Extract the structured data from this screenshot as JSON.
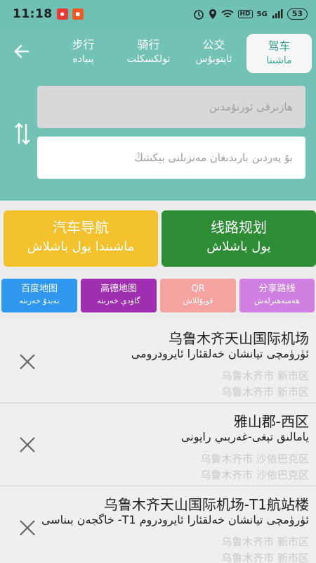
{
  "status": {
    "time": "11:18",
    "network": "5G",
    "hd": "HD",
    "battery": "53"
  },
  "header": {
    "tabs": [
      {
        "zh": "步行",
        "ug": "پىيادە"
      },
      {
        "zh": "骑行",
        "ug": "تولكسكلت"
      },
      {
        "zh": "公交",
        "ug": "ئاپتوبۇس"
      },
      {
        "zh": "驾车",
        "ug": "ماشىنا"
      }
    ],
    "from_placeholder": "ھازىرقى ئورنۇمدىن",
    "to_placeholder": "بۇ يەردىن بارىدىغان مەنزىلنى بېكىتىڭ"
  },
  "actions": {
    "nav": {
      "zh": "汽车导航",
      "ug": "ماشىندا يول باشلاش"
    },
    "plan": {
      "zh": "线路规划",
      "ug": "يول باشلاش"
    }
  },
  "quick": [
    {
      "zh": "百度地图",
      "ug": "بەيدۇ خەرىتە"
    },
    {
      "zh": "高德地图",
      "ug": "گاۋدې خەرىتە"
    },
    {
      "zh": "QR",
      "ug": "قويۇللاش"
    },
    {
      "zh": "分享路线",
      "ug": "ھەمبەھىرلەش"
    }
  ],
  "history": [
    {
      "title": "乌鲁木齐天山国际机场",
      "subtitle": "ئۈرۈمچى تيانشان خەلقئارا ئايرودرومى",
      "loc1": "乌鲁木齐市 新市区",
      "loc2": "乌鲁木齐市 新市区"
    },
    {
      "title": "雅山郡-西区",
      "subtitle": "يامالىق تېغى-غەربىي رايونى",
      "loc1": "乌鲁木齐市 沙依巴克区",
      "loc2": "乌鲁木齐市 沙依巴克区"
    },
    {
      "title": "乌鲁木齐天山国际机场-T1航站楼",
      "subtitle": "ئۈرۈمچى تيانشان خەلقئارا ئايرودروم T1- خاگجەن بىناسى",
      "loc1": "乌鲁木齐市 新市区",
      "loc2": "乌鲁木齐市 新市区"
    }
  ],
  "colors": {
    "teal": "#72c2b5",
    "yellow": "#f4c12e",
    "green": "#2d8d35",
    "blue": "#2f97ee",
    "purple": "#9f2eb0",
    "pink": "#f4a3a0",
    "violet": "#d080e0"
  }
}
